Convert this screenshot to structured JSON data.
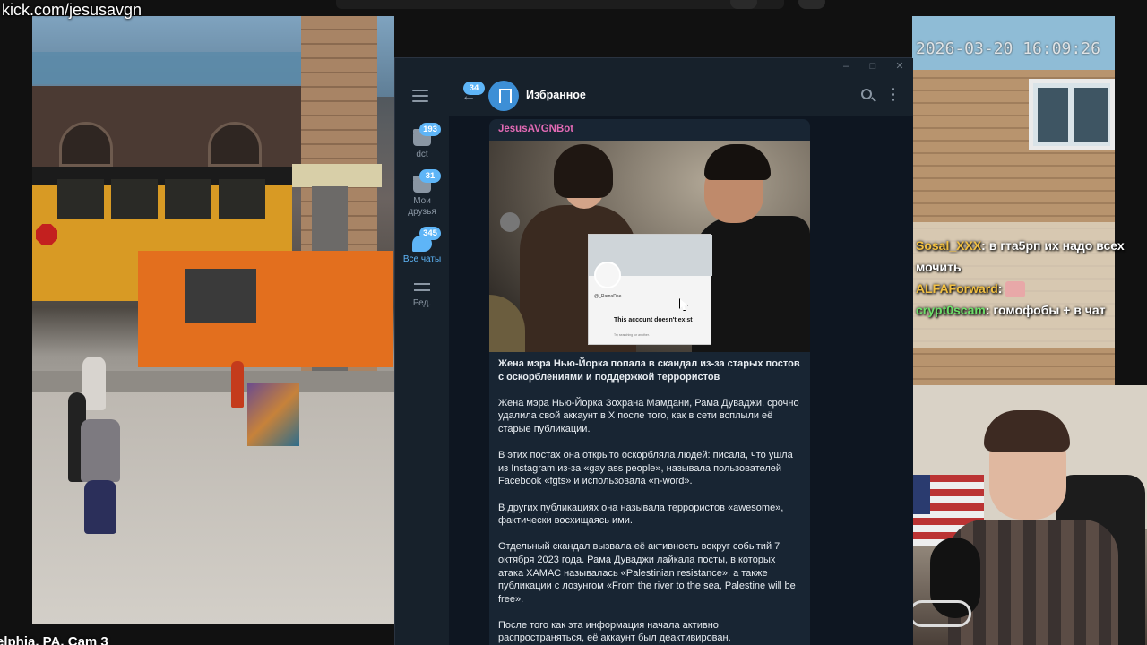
{
  "stream": {
    "url_overlay": "kick.com/jesusavgn",
    "street_cam_label": "elphia, PA, Cam 3",
    "timestamp": "2026-03-20 16:09:26"
  },
  "chat_overlay": {
    "messages": [
      {
        "user": "Sosal_XXX",
        "text": ": в гта5рп их надо всех мочить",
        "user_color": "#f2c043"
      },
      {
        "user": "ALFAForward",
        "text": ":",
        "user_color": "#f2c043",
        "emote": "pink-face-emote"
      },
      {
        "user": "crypt0scam",
        "text": ": гомофобы + в чат",
        "user_color": "#6ee06b"
      }
    ]
  },
  "telegram": {
    "sidebar": {
      "menu_icon": "hamburger-icon",
      "folders": [
        {
          "label": "dct",
          "badge": "193",
          "active": false,
          "icon": "folder-icon"
        },
        {
          "label": "Мои друзья",
          "badge": "31",
          "active": false,
          "icon": "folder-icon"
        },
        {
          "label": "Все чаты",
          "badge": "345",
          "active": true,
          "icon": "chats-icon"
        },
        {
          "label": "Ред.",
          "badge": "",
          "active": false,
          "icon": "edit-folders-icon"
        }
      ]
    },
    "header": {
      "back_badge": "34",
      "title": "Избранное",
      "icons": [
        "search-icon",
        "more-icon"
      ]
    },
    "message": {
      "sender": "JesusAVGNBot",
      "embedded_card": {
        "handle": "@_RamaDee",
        "status": "This account doesn't exist",
        "subtext": "Try searching for another."
      },
      "paragraphs": [
        "Жена мэра Нью-Йорка попала в скандал из-за старых постов с оскорблениями и поддержкой террористов",
        "Жена мэра Нью-Йорка Зохрана Мамдани, Рама Дуваджи, срочно удалила свой аккаунт в X после того, как в сети всплыли её старые публикации.",
        "В этих постах она открыто оскорбляла людей: писала, что ушла из Instagram из-за «gay ass people», называла пользователей Facebook «fgts» и использовала «n-word».",
        "В других публикациях она называла террористов «awesome», фактически восхищаясь ими.",
        "Отдельный скандал вызвала её активность вокруг событий 7 октября 2023 года. Рама Дуваджи лайкала посты, в которых атака ХАМАС называлась «Palestinian resistance», а также публикации с лозунгом «From the river to the sea, Palestine will be free».",
        "После того как эта информация начала активно распространяться, её аккаунт был деактивирован."
      ]
    }
  }
}
